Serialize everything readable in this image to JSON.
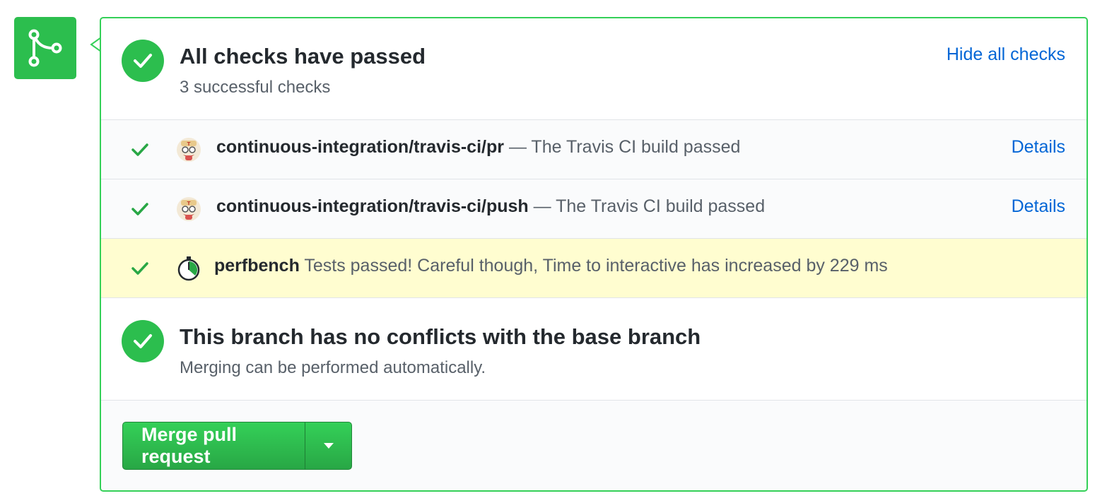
{
  "status": {
    "title": "All checks have passed",
    "subtitle": "3 successful checks",
    "toggle_link": "Hide all checks"
  },
  "checks": [
    {
      "name": "continuous-integration/travis-ci/pr",
      "description": "— The Travis CI build passed",
      "link": "Details",
      "avatar": "travis-ci-mascot-icon",
      "highlighted": false
    },
    {
      "name": "continuous-integration/travis-ci/push",
      "description": "— The Travis CI build passed",
      "link": "Details",
      "avatar": "travis-ci-mascot-icon",
      "highlighted": false
    },
    {
      "name": "perfbench",
      "description": "Tests passed! Careful though, Time to interactive has increased by 229 ms",
      "link": "",
      "avatar": "stopwatch-icon",
      "highlighted": true
    }
  ],
  "merge": {
    "title": "This branch has no conflicts with the base branch",
    "subtitle": "Merging can be performed automatically.",
    "button_label": "Merge pull request"
  },
  "colors": {
    "success": "#2cbe4e",
    "link": "#0366d6",
    "highlight": "#fffdd0"
  }
}
